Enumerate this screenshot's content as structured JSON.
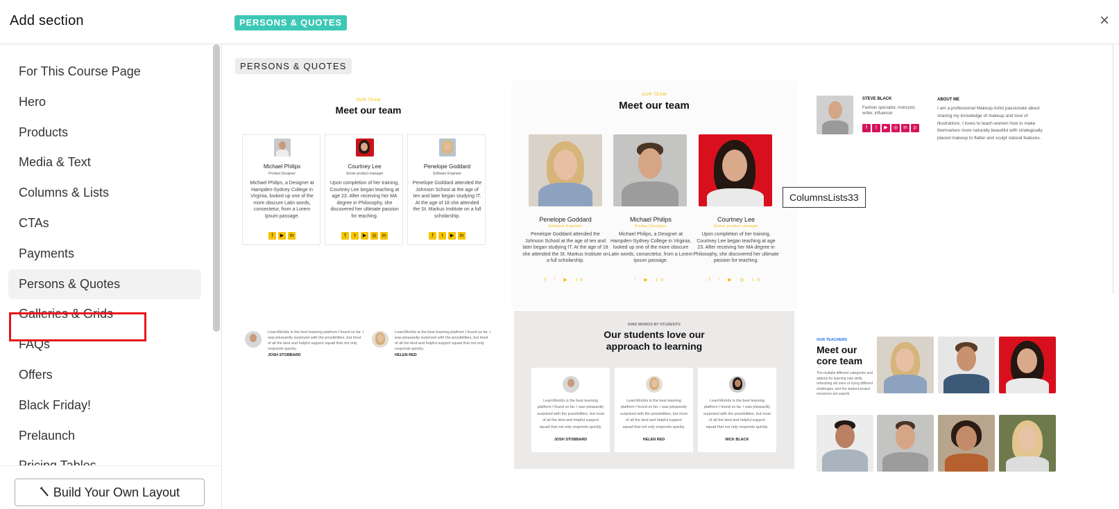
{
  "header": {
    "title": "Add section",
    "badge": "PERSONS & QUOTES",
    "close": "×"
  },
  "sidebar": {
    "items": [
      {
        "label": "For This Course Page"
      },
      {
        "label": "Hero"
      },
      {
        "label": "Products"
      },
      {
        "label": "Media & Text"
      },
      {
        "label": "Columns & Lists"
      },
      {
        "label": "CTAs"
      },
      {
        "label": "Payments"
      },
      {
        "label": "Persons & Quotes"
      },
      {
        "label": "Galleries & Grids"
      },
      {
        "label": "FAQs"
      },
      {
        "label": "Offers"
      },
      {
        "label": "Black Friday!"
      },
      {
        "label": "Prelaunch"
      },
      {
        "label": "Pricing Tables"
      }
    ],
    "active_index": 7,
    "build_button": "Build Your Own Layout"
  },
  "main": {
    "section_tag": "PERSONS & QUOTES",
    "tooltip": "ColumnsLists33",
    "card1": {
      "eyebrow": "OUR TEAM",
      "heading": "Meet our team",
      "people": [
        {
          "name": "Michael Philips",
          "role": "Product Designer",
          "bio": "Michael Philips, a Designer at Hampden-Sydney College in Virginia, looked up one of the more obscure Latin words, consectetur, from a Lorem Ipsum passage."
        },
        {
          "name": "Courtney Lee",
          "role": "Senior product manager",
          "bio": "Upon completion of her training, Courtney Lee began teaching at age 23. After receiving her MA degree in Philosophy, she discovered her ultimate passion for teaching."
        },
        {
          "name": "Penelope Goddard",
          "role": "Software Engineer",
          "bio": "Penelope Goddard attended the Johnson School at the age of ten and later began studying IT. At the age of 18 she attended the St. Markus Institute on a full scholarship."
        }
      ]
    },
    "card2": {
      "eyebrow": "OUR TEAM",
      "heading": "Meet our team",
      "people": [
        {
          "name": "Penelope Goddard",
          "role": "Software Engineer",
          "bio": "Penelope Goddard attended the Johnson School at the age of ten and later began studying IT. At the age of 18 she attended the St. Markus Institute on a full scholarship."
        },
        {
          "name": "Michael Philips",
          "role": "Product Designer",
          "bio": "Michael Philips, a Designer at Hampden-Sydney College in Virginia, looked up one of the more obscure Latin words, consectetur, from a Lorem Ipsum passage."
        },
        {
          "name": "Courtney Lee",
          "role": "Senior product manager",
          "bio": "Upon completion of her training, Courtney Lee began teaching at age 23. After receiving her MA degree in Philosophy, she discovered her ultimate passion for teaching."
        }
      ]
    },
    "card3": {
      "name": "STEVE BLACK",
      "role": "Fashion specialist, instructor, writer, influencer",
      "about_label": "ABOUT ME",
      "about": "I am a professional Makeup Artist passionate about sharing my knowledge of makeup and love of illustrations. I loves to teach women how to make themselves more naturally beautiful with strategically placed makeup to flatter and sculpt natural features."
    },
    "card4": {
      "quotes": [
        {
          "text": "LearnWorlds is the best learning platform I found so far. I was pleasantly surprised with the possibilities, but most of all the kind and helpful support squad that not only responds quickly.",
          "author": "JOSH STOBBARD"
        },
        {
          "text": "LearnWorlds is the best learning platform I found so far. I was pleasantly surprised with the possibilities, but most of all the kind and helpful support squad that not only responds quickly.",
          "author": "HELEN RED"
        }
      ]
    },
    "card5": {
      "eyebrow": "KIND WORDS BY STUDENTS",
      "heading_line1": "Our students love our",
      "heading_line2": "approach to learning",
      "quotes": [
        {
          "text": "LearnWorlds is the best learning platform I found so far. I was pleasantly surprised with the possibilities, but most of all the kind and helpful support squad that not only responds quickly.",
          "author": "JOSH STOBBARD"
        },
        {
          "text": "LearnWorlds is the best learning platform I found so far. I was pleasantly surprised with the possibilities, but most of all the kind and helpful support squad that not only responds quickly.",
          "author": "HELEN RED"
        },
        {
          "text": "LearnWorlds is the best learning platform I found so far. I was pleasantly surprised with the possibilities, but most of all the kind and helpful support squad that not only responds quickly.",
          "author": "NICK BLACK"
        }
      ]
    },
    "card6": {
      "eyebrow": "OUR TEACHERS",
      "heading_line1": "Meet our",
      "heading_line2": "core team",
      "text": "The multiple different categories and options for learning new skills, refreshing old ones or trying different challenges, and the student project resources are superb."
    }
  },
  "colors": {
    "badge": "#3cc8b4",
    "highlight": "#e8141b",
    "accent_yellow": "#f5c400",
    "social_red": "#d4145a",
    "teacher_blue": "#1a73e8"
  }
}
